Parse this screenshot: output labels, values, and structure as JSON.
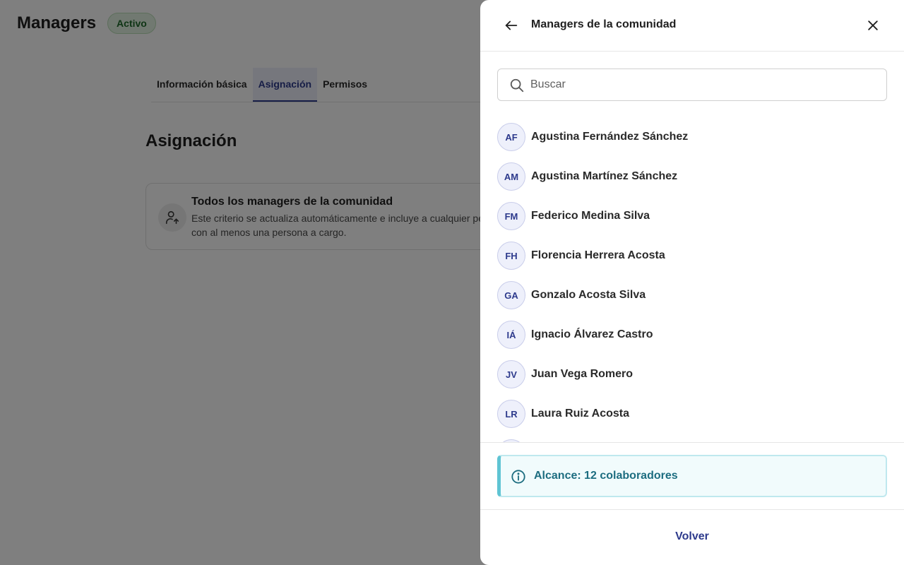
{
  "page": {
    "title": "Managers",
    "status": "Activo",
    "tabs": [
      {
        "label": "Información básica"
      },
      {
        "label": "Asignación"
      },
      {
        "label": "Permisos"
      }
    ],
    "section_title": "Asignación",
    "criteria": {
      "title": "Todos los managers de la comunidad",
      "description": "Este criterio se actualiza automáticamente e incluye a cualquier persona con al menos una persona a cargo."
    }
  },
  "drawer": {
    "title": "Managers de la comunidad",
    "search_placeholder": "Buscar",
    "managers": [
      {
        "initials": "AF",
        "name": "Agustina Fernández Sánchez"
      },
      {
        "initials": "AM",
        "name": "Agustina Martínez Sánchez"
      },
      {
        "initials": "FM",
        "name": "Federico Medina Silva"
      },
      {
        "initials": "FH",
        "name": "Florencia Herrera Acosta"
      },
      {
        "initials": "GA",
        "name": "Gonzalo Acosta Silva"
      },
      {
        "initials": "IÁ",
        "name": "Ignacio Álvarez Castro"
      },
      {
        "initials": "JV",
        "name": "Juan Vega Romero"
      },
      {
        "initials": "LR",
        "name": "Laura Ruiz Acosta"
      }
    ],
    "scope_text": "Alcance: 12 colaboradores",
    "volver_label": "Volver"
  },
  "icons": {
    "back": "arrow-left-icon",
    "close": "close-icon",
    "search": "search-icon",
    "info": "info-icon",
    "criteria": "user-up-icon"
  },
  "colors": {
    "accent": "#2d3a8c",
    "active_badge": "#1e6b2a",
    "info": "#1d6d80"
  }
}
